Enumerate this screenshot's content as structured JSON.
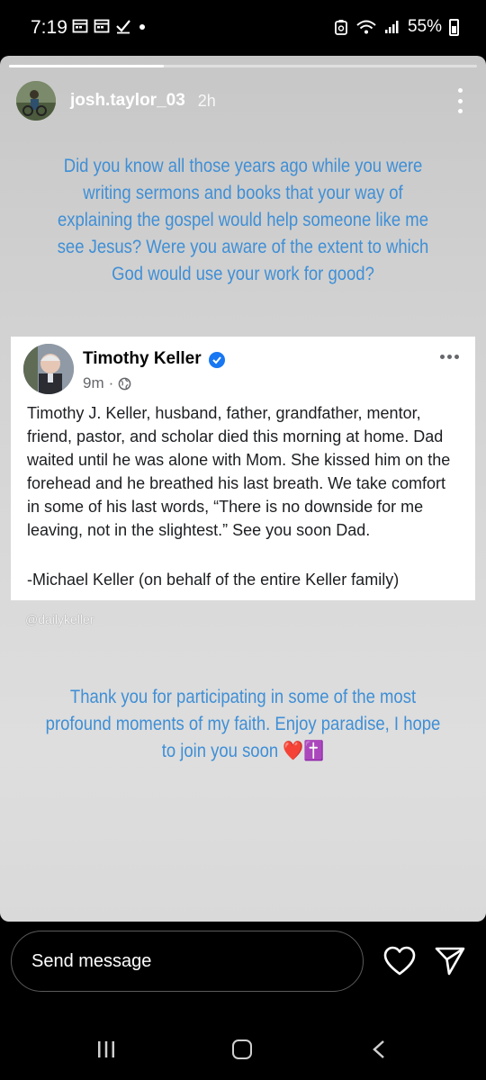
{
  "status_bar": {
    "time": "7:19",
    "battery_percent": "55%",
    "icons_left": [
      "calendar-icon",
      "calendar-icon",
      "checkmark-icon",
      "dot-icon"
    ],
    "icons_right": [
      "data-saver-icon",
      "wifi-icon",
      "signal-icon",
      "battery-icon"
    ]
  },
  "story": {
    "progress": 0.33,
    "username": "josh.taylor_03",
    "time_ago": "2h",
    "caption_top": "Did you know all those years ago while you were writing sermons and books that your way of explaining the gospel would help someone like me  see Jesus?  Were you aware of the extent to which God would use your work for good?",
    "caption_bottom": "Thank you for participating in some of the most profound moments of my faith. Enjoy paradise, I hope to join you soon ❤️✝️",
    "accent_color": "#3f8fd6",
    "watermark": "@dailykeller"
  },
  "post": {
    "author": "Timothy Keller",
    "verified": true,
    "time": "9m",
    "audience_icon": "globe-icon",
    "body": "Timothy J. Keller, husband, father, grandfather, mentor, friend, pastor, and scholar died this morning at home. Dad waited until he was alone with Mom. She kissed him on the forehead and he breathed his last breath. We take comfort in some of his last words, “There is no downside for me leaving, not in the slightest.” See you soon Dad.",
    "signature": "-Michael Keller (on behalf of the entire Keller family)"
  },
  "reply_bar": {
    "placeholder": "Send message",
    "icons": [
      "heart-icon",
      "send-icon"
    ]
  },
  "nav_bar": {
    "icons": [
      "recents-icon",
      "home-icon",
      "back-icon"
    ]
  }
}
